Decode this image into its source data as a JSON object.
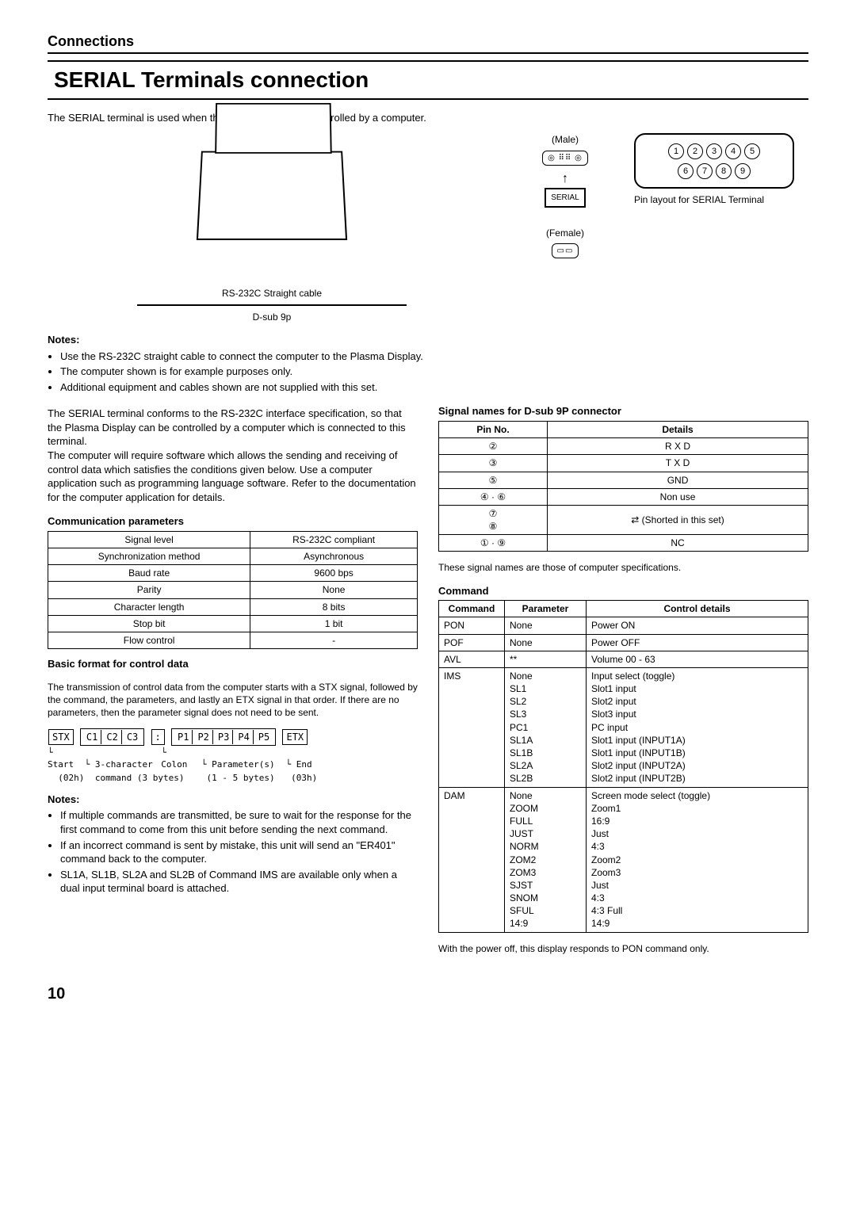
{
  "header": {
    "section": "Connections",
    "title": "SERIAL Terminals connection"
  },
  "intro": "The SERIAL terminal is used when the Plasma Display is controlled by a computer.",
  "diagram": {
    "computer": "COMPUTER",
    "cable": "RS-232C Straight cable",
    "dsub": "D-sub 9p",
    "male": "(Male)",
    "female": "(Female)",
    "serial_label": "SERIAL",
    "pin_caption": "Pin layout for SERIAL Terminal"
  },
  "notes1_h": "Notes:",
  "notes1": [
    "Use the RS-232C straight cable to connect the computer to the Plasma Display.",
    "The computer shown is for example purposes only.",
    "Additional equipment and cables shown are not supplied with this set."
  ],
  "serial_para": "The SERIAL terminal conforms to the RS-232C interface specification, so that the Plasma Display can be controlled by a computer which is connected to this terminal.\nThe computer will require software which allows the sending and receiving of control data which satisfies the conditions given below. Use a computer application such as programming language software. Refer to the documentation for the computer application for details.",
  "comm_h": "Communication parameters",
  "comm_table": [
    [
      "Signal level",
      "RS-232C compliant"
    ],
    [
      "Synchronization method",
      "Asynchronous"
    ],
    [
      "Baud rate",
      "9600 bps"
    ],
    [
      "Parity",
      "None"
    ],
    [
      "Character length",
      "8 bits"
    ],
    [
      "Stop bit",
      "1 bit"
    ],
    [
      "Flow control",
      "-"
    ]
  ],
  "format_h": "Basic format for control data",
  "format_p": "The transmission of control data from the computer starts with a STX signal, followed by the command, the parameters, and lastly an ETX signal in that order. If there are no parameters, then the parameter signal does not need to be sent.",
  "format_boxes": {
    "stx": "STX",
    "c1": "C1",
    "c2": "C2",
    "c3": "C3",
    "colon": ":",
    "p1": "P1",
    "p2": "P2",
    "p3": "P3",
    "p4": "P4",
    "p5": "P5",
    "etx": "ETX",
    "lbl_start": "Start",
    "lbl_start2": "(02h)",
    "lbl_cmd": "3-character",
    "lbl_cmd2": "command (3 bytes)",
    "lbl_colon": "Colon",
    "lbl_param": "Parameter(s)",
    "lbl_param2": "(1 - 5 bytes)",
    "lbl_end": "End",
    "lbl_end2": "(03h)"
  },
  "notes2_h": "Notes:",
  "notes2": [
    "If multiple commands are transmitted, be sure to wait for the response for the first command to come from this unit before sending the next command.",
    "If an incorrect command is sent by mistake, this unit will send an \"ER401\" command back to the computer.",
    "SL1A, SL1B, SL2A and SL2B of Command IMS are available only when a dual input terminal board is attached."
  ],
  "signal_h": "Signal names for D-sub 9P connector",
  "signal_table": {
    "head": [
      "Pin No.",
      "Details"
    ],
    "rows": [
      [
        "②",
        "R X D"
      ],
      [
        "③",
        "T X D"
      ],
      [
        "⑤",
        "GND"
      ],
      [
        "④ · ⑥",
        "Non use"
      ],
      [
        "⑦\n⑧",
        "⇄  (Shorted in this set)"
      ],
      [
        "① · ⑨",
        "NC"
      ]
    ]
  },
  "signal_note": "These signal names are those of computer specifications.",
  "cmd_h": "Command",
  "cmd_table": {
    "head": [
      "Command",
      "Parameter",
      "Control details"
    ],
    "rows": [
      [
        "PON",
        "None",
        "Power ON"
      ],
      [
        "POF",
        "None",
        "Power OFF"
      ],
      [
        "AVL",
        "**",
        "Volume 00 - 63"
      ],
      [
        "IMS",
        "None\nSL1\nSL2\nSL3\nPC1\nSL1A\nSL1B\nSL2A\nSL2B",
        "Input select (toggle)\nSlot1 input\nSlot2 input\nSlot3 input\nPC input\nSlot1 input (INPUT1A)\nSlot1 input (INPUT1B)\nSlot2 input (INPUT2A)\nSlot2 input (INPUT2B)"
      ],
      [
        "DAM",
        "None\nZOOM\nFULL\nJUST\nNORM\nZOM2\nZOM3\nSJST\nSNOM\nSFUL\n14:9",
        "Screen mode select (toggle)\nZoom1\n16:9\nJust\n4:3\nZoom2\nZoom3\nJust\n4:3\n4:3 Full\n14:9"
      ]
    ]
  },
  "cmd_note": "With the power off, this display responds to PON command only.",
  "page": "10"
}
